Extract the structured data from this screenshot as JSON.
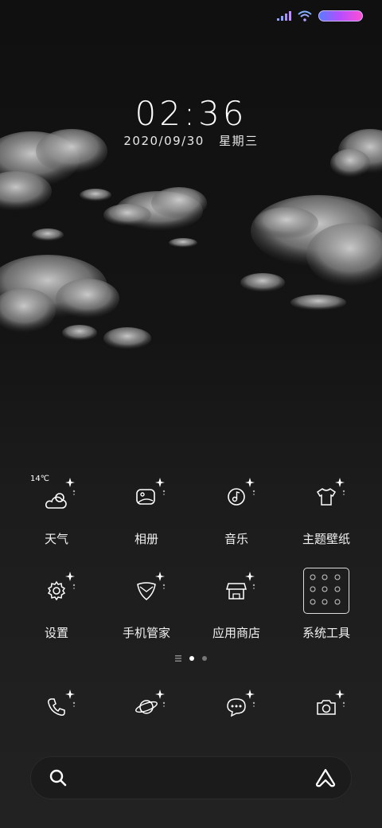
{
  "status": {
    "signal_icon": "signal-icon",
    "wifi_icon": "wifi-icon",
    "battery_icon": "battery-icon"
  },
  "lockscreen": {
    "time": "02:36",
    "date": "2020/09/30",
    "weekday": "星期三"
  },
  "weather_badge": "14℃",
  "apps_row1": [
    {
      "label": "天气",
      "icon": "weather-icon"
    },
    {
      "label": "相册",
      "icon": "gallery-icon"
    },
    {
      "label": "音乐",
      "icon": "music-icon"
    },
    {
      "label": "主题壁纸",
      "icon": "theme-icon"
    }
  ],
  "apps_row2": [
    {
      "label": "设置",
      "icon": "gear-icon"
    },
    {
      "label": "手机管家",
      "icon": "shield-icon"
    },
    {
      "label": "应用商店",
      "icon": "store-icon"
    },
    {
      "label": "系统工具",
      "icon": "folder-icon"
    }
  ],
  "dock": [
    {
      "icon": "phone-icon"
    },
    {
      "icon": "browser-planet-icon"
    },
    {
      "icon": "messages-icon"
    },
    {
      "icon": "camera-icon"
    }
  ],
  "page_indicator": {
    "pages": 2,
    "current": 1
  },
  "search_bar": {
    "search_icon": "search-icon",
    "assistant_icon": "assistant-icon"
  }
}
